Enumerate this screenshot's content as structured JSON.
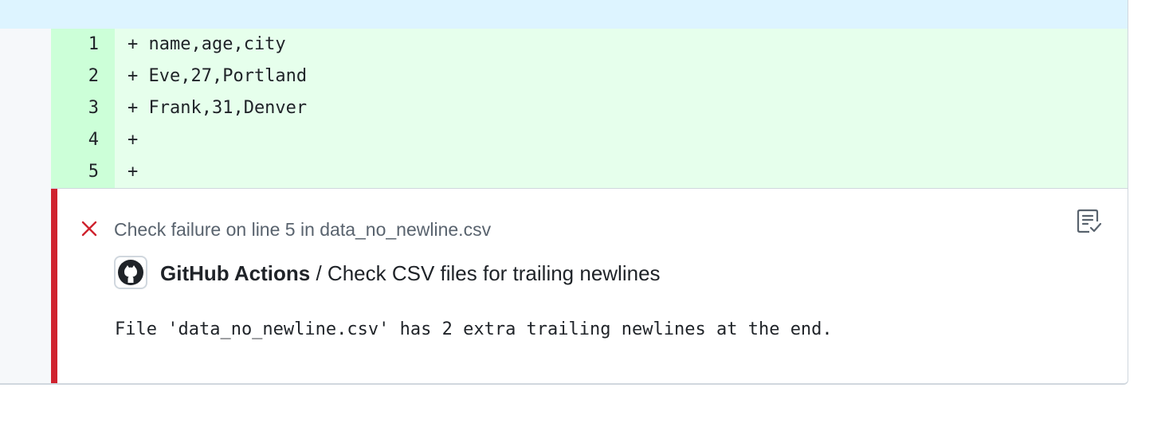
{
  "diff": {
    "lines": [
      {
        "number": "1",
        "code": "+ name,age,city"
      },
      {
        "number": "2",
        "code": "+ Eve,27,Portland"
      },
      {
        "number": "3",
        "code": "+ Frank,31,Denver"
      },
      {
        "number": "4",
        "code": "+"
      },
      {
        "number": "5",
        "code": "+"
      }
    ]
  },
  "annotation": {
    "status_icon": "x-icon",
    "title": "Check failure on line 5 in data_no_newline.csv",
    "app_icon": "github-logo-icon",
    "app_name": "GitHub Actions",
    "separator": " / ",
    "check_name": "Check CSV files for trailing newlines",
    "message": "File 'data_no_newline.csv' has 2 extra trailing newlines at the end.",
    "action_icon": "file-check-icon"
  },
  "colors": {
    "added_line_bg": "#e6ffec",
    "added_gutter_bg": "#ccffd8",
    "hunk_header_bg": "#ddf4ff",
    "failure_accent": "#cf222e"
  }
}
